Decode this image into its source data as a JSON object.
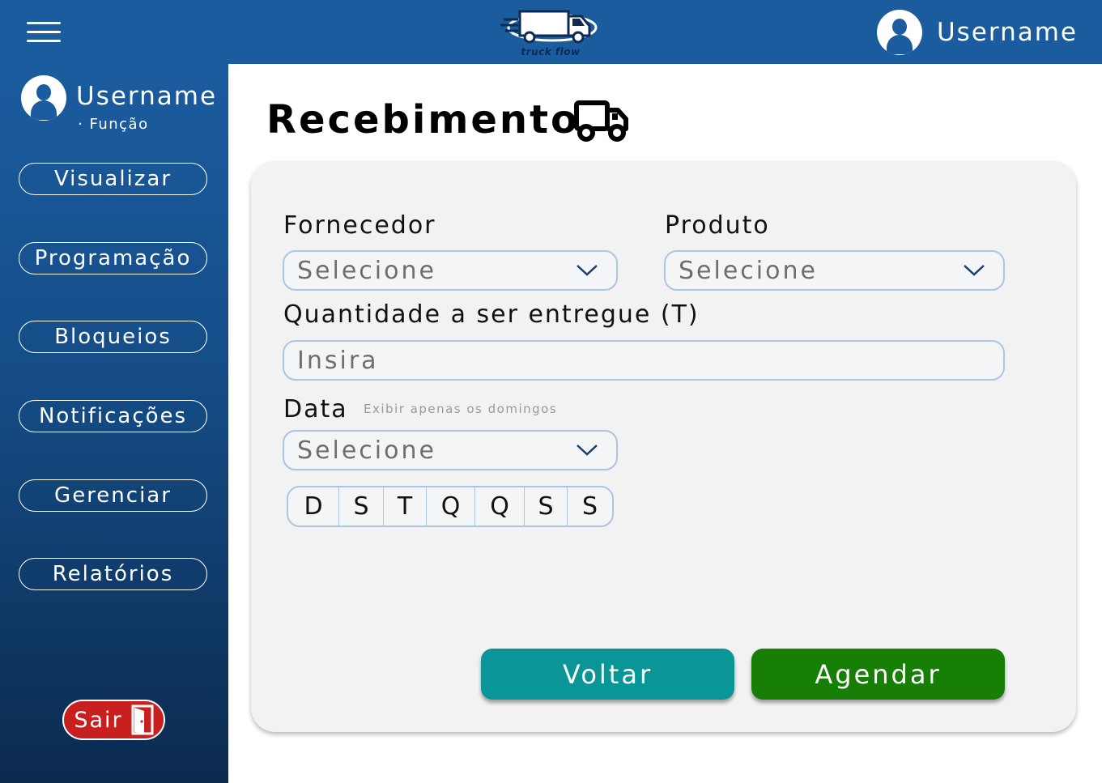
{
  "header": {
    "menu_icon": "hamburger-menu-icon",
    "logo_text": "truck flow",
    "username": "Username",
    "avatar_icon": "user-avatar-icon",
    "color": "#1b5c9f"
  },
  "sidebar": {
    "username": "Username",
    "role": "Função",
    "items": [
      {
        "label": "Visualizar"
      },
      {
        "label": "Programação"
      },
      {
        "label": "Bloqueios"
      },
      {
        "label": "Notificações"
      },
      {
        "label": "Gerenciar"
      },
      {
        "label": "Relatórios"
      }
    ],
    "logout_label": "Sair",
    "logout_icon": "exit-door-icon",
    "logout_color": "#c8201f"
  },
  "page": {
    "title": "Recebimento",
    "title_icon": "truck-icon"
  },
  "form": {
    "supplier_label": "Fornecedor",
    "supplier_value": "Selecione",
    "product_label": "Produto",
    "product_value": "Selecione",
    "quantity_label": "Quantidade a ser entregue (T)",
    "quantity_placeholder": "Insira",
    "date_label": "Data",
    "date_hint": "Exibir apenas os domingos",
    "date_value": "Selecione",
    "weekdays": [
      "D",
      "S",
      "T",
      "Q",
      "Q",
      "S",
      "S"
    ],
    "back_label": "Voltar",
    "back_color": "#0a9696",
    "submit_label": "Agendar",
    "submit_color": "#177e06"
  }
}
